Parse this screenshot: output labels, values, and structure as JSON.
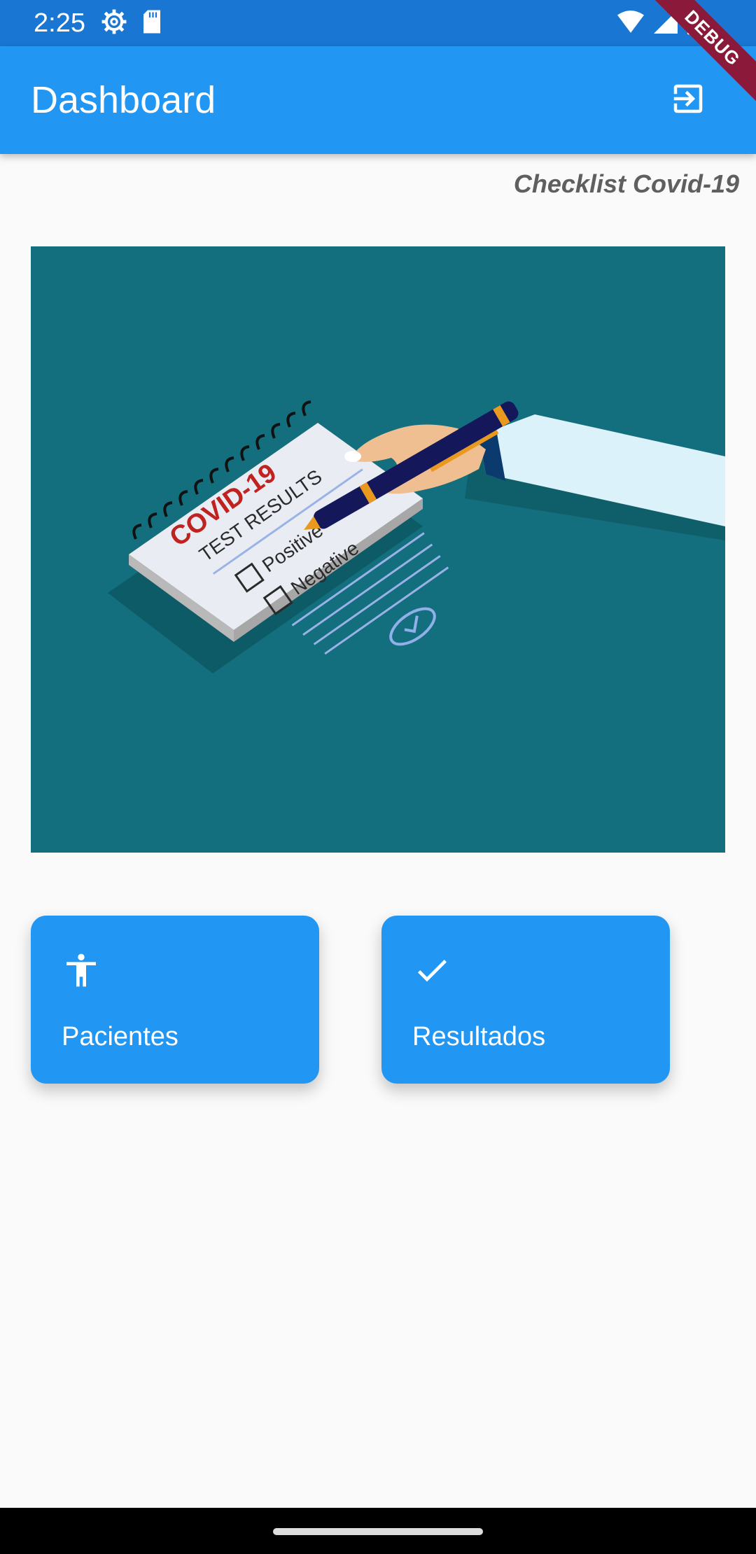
{
  "status_bar": {
    "time": "2:25",
    "icons": [
      "settings-icon",
      "sd-card-icon",
      "wifi-icon",
      "signal-icon",
      "battery-icon"
    ],
    "debug_label": "DEBUG"
  },
  "app_bar": {
    "title": "Dashboard",
    "action_icon": "logout-icon"
  },
  "subtitle": "Checklist Covid-19",
  "hero_image": {
    "heading": "COVID-19",
    "subheading": "TEST RESULTS",
    "options": [
      "Positive",
      "Negative"
    ]
  },
  "cards": [
    {
      "label": "Pacientes",
      "icon": "accessibility-icon"
    },
    {
      "label": "Resultados",
      "icon": "check-icon"
    }
  ],
  "colors": {
    "status_bar": "#1976d2",
    "primary": "#2196f3",
    "hero_background": "#136e7d",
    "background": "#fafafa"
  }
}
